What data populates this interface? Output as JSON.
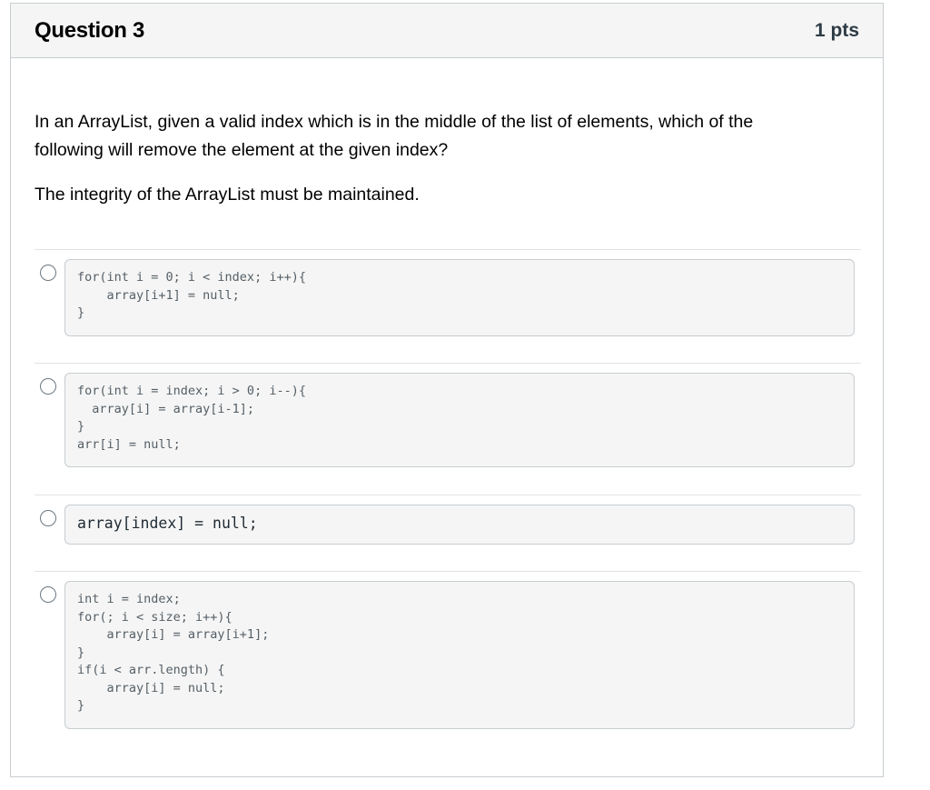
{
  "question": {
    "title": "Question 3",
    "points": "1 pts",
    "text_paragraphs": [
      "In an ArrayList, given a valid index which is in the middle of the list of elements, which of the following will remove the element at the given index?",
      "The integrity of the ArrayList must be maintained."
    ]
  },
  "answers": [
    {
      "code": "for(int i = 0; i < index; i++){\n    array[i+1] = null;\n}"
    },
    {
      "code": "for(int i = index; i > 0; i--){\n  array[i] = array[i-1];\n}\narr[i] = null;"
    },
    {
      "code": "array[index] = null;"
    },
    {
      "code": "int i = index;\nfor(; i < size; i++){\n    array[i] = array[i+1];\n}\nif(i < arr.length) {\n    array[i] = null;\n}"
    }
  ]
}
